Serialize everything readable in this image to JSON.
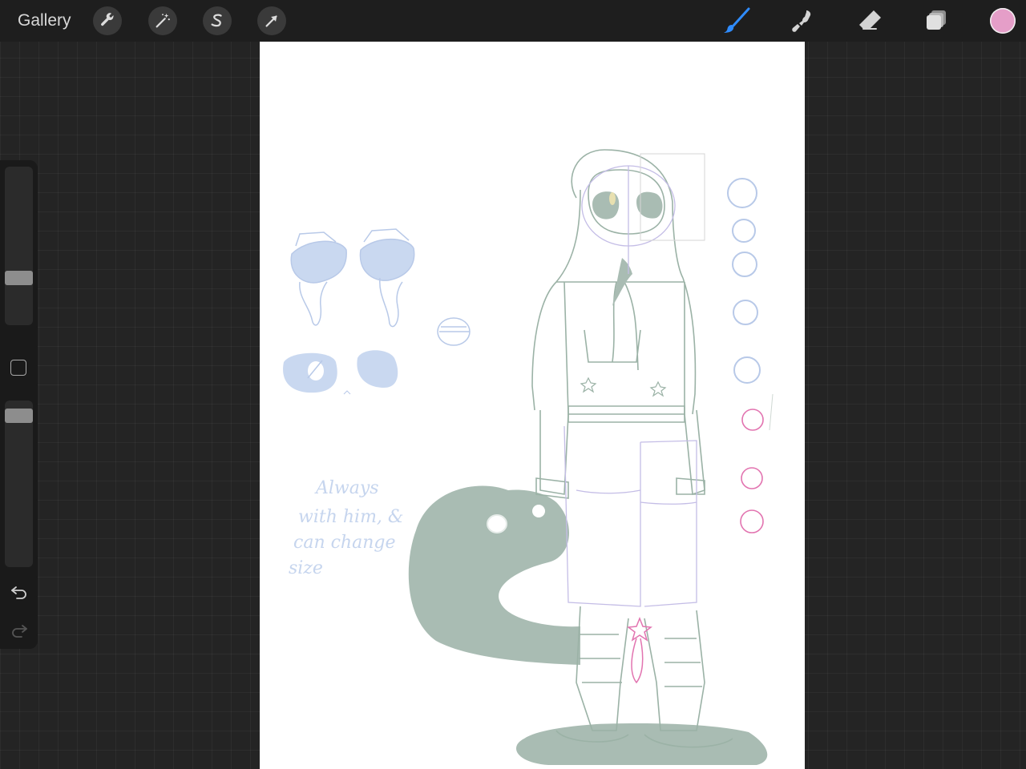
{
  "topbar": {
    "gallery_label": "Gallery",
    "left_tools": [
      {
        "icon": "wrench-icon",
        "name": "actions"
      },
      {
        "icon": "magic-wand-icon",
        "name": "adjustments"
      },
      {
        "icon": "s-selection-icon",
        "name": "selection"
      },
      {
        "icon": "arrow-cursor-icon",
        "name": "transform"
      }
    ],
    "right_tools": [
      {
        "icon": "brush-icon",
        "name": "paint",
        "active": true
      },
      {
        "icon": "smudge-icon",
        "name": "smudge"
      },
      {
        "icon": "eraser-icon",
        "name": "eraser"
      },
      {
        "icon": "layers-icon",
        "name": "layers"
      }
    ],
    "current_color": "#e59ec8"
  },
  "sidebar": {
    "brush_size_level": 0.35,
    "opacity_level": 0.95
  },
  "canvas": {
    "handwritten_note": [
      "Always",
      "with him, &",
      "can change",
      "size"
    ]
  },
  "colors": {
    "accent": "#2f8cff",
    "sketch_green": "#9bb2a6",
    "sketch_blue": "#b8c9e8",
    "sketch_pink": "#e274b0",
    "shadow_fill": "#a9bcb3"
  }
}
